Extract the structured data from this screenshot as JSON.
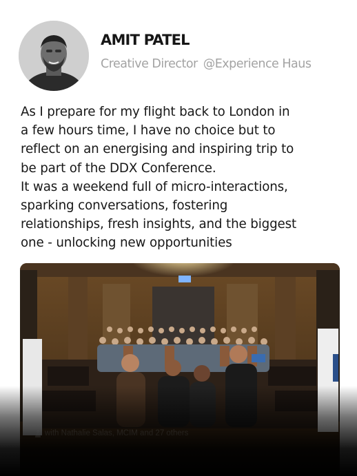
{
  "post": {
    "author_name": "AMIT PATEL",
    "author_title": "Creative Director",
    "author_company": "@Experience Haus",
    "body_lines": [
      "As I prepare for my flight back to London in",
      "a few hours time, I have no choice but to",
      "reflect on an energising and inspiring trip to",
      "be part of the DDX Conference.",
      "It was a weekend full of micro-interactions,",
      "sparking conversations, fostering",
      "relationships, fresh insights, and the biggest",
      "one - unlocking new opportunities"
    ],
    "photo_tag": "with Nathalie Salas, MCIM and 27 others"
  },
  "icons": {
    "avatar": "profile-photo",
    "tag": "person-icon"
  }
}
